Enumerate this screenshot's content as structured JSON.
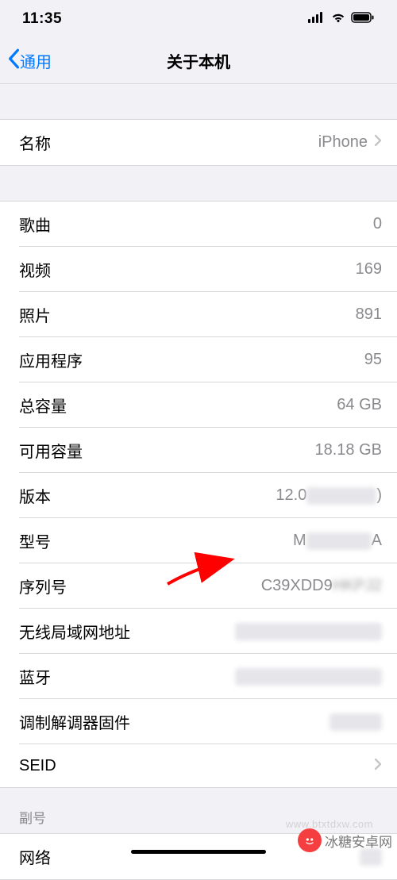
{
  "status_bar": {
    "time": "11:35"
  },
  "nav": {
    "back_label": "通用",
    "title": "关于本机"
  },
  "name_row": {
    "label": "名称",
    "value": "iPhone"
  },
  "info_rows": [
    {
      "label": "歌曲",
      "value": "0"
    },
    {
      "label": "视频",
      "value": "169"
    },
    {
      "label": "照片",
      "value": "891"
    },
    {
      "label": "应用程序",
      "value": "95"
    },
    {
      "label": "总容量",
      "value": "64 GB"
    },
    {
      "label": "可用容量",
      "value": "18.18 GB"
    },
    {
      "label": "版本",
      "value_prefix": "12.0",
      "value_suffix": ")"
    },
    {
      "label": "型号",
      "value_prefix": "M",
      "value_suffix": "A"
    },
    {
      "label": "序列号",
      "value_prefix": "C39XDD9",
      "value_suffix": "HKPJ2"
    },
    {
      "label": "无线局域网地址",
      "value": ""
    },
    {
      "label": "蓝牙",
      "value": ""
    },
    {
      "label": "调制解调器固件",
      "value": ""
    },
    {
      "label": "SEID",
      "value": ""
    }
  ],
  "section2_header": "副号",
  "section2_rows": [
    {
      "label": "网络",
      "value": ""
    }
  ],
  "watermark": {
    "url": "www.btxtdxw.com",
    "text": "冰糖安卓网"
  }
}
